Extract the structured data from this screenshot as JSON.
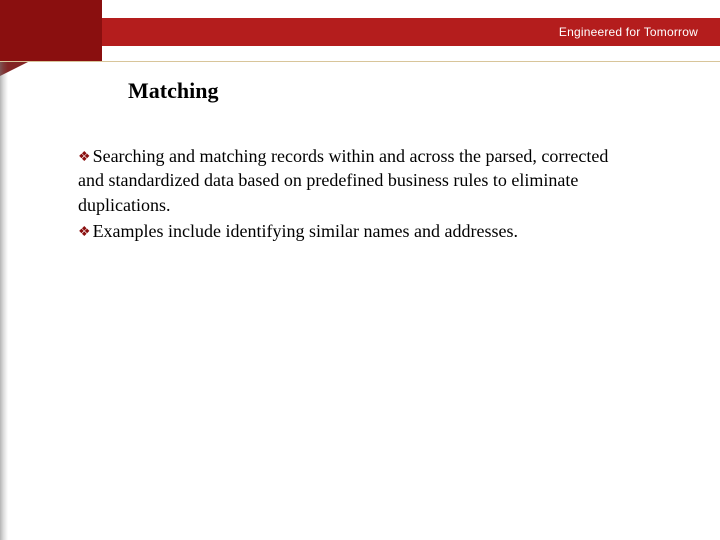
{
  "colors": {
    "brand_red": "#b41d1d",
    "brand_red_dark": "#8a0f0f",
    "divider": "#d8c59a"
  },
  "header": {
    "tagline": "Engineered for Tomorrow"
  },
  "slide": {
    "title": "Matching",
    "bullets": [
      "Searching and matching records within and across the parsed, corrected and standardized data based on predefined business rules to eliminate duplications.",
      "Examples include identifying similar names and addresses."
    ]
  },
  "icons": {
    "bullet": "❖"
  }
}
